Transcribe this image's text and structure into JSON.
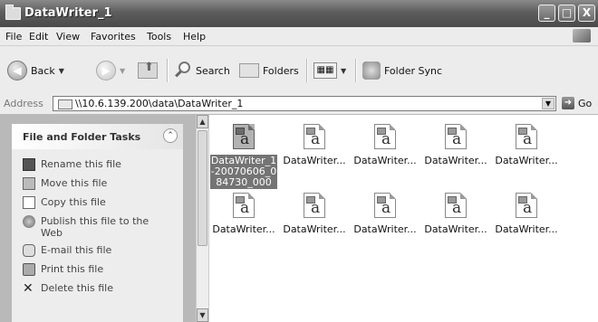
{
  "window": {
    "title": "DataWriter_1",
    "buttons": {
      "minimize": "_",
      "maximize": "□",
      "close": "X"
    }
  },
  "menu": {
    "file": "File",
    "edit": "Edit",
    "view": "View",
    "favorites": "Favorites",
    "tools": "Tools",
    "help": "Help"
  },
  "toolbar": {
    "back": "Back",
    "search": "Search",
    "folders": "Folders",
    "folder_sync": "Folder Sync"
  },
  "address": {
    "label": "Address",
    "value": "\\\\10.6.139.200\\data\\DataWriter_1",
    "go": "Go"
  },
  "tasks": {
    "title": "File and Folder Tasks",
    "items": [
      {
        "label": "Rename this file",
        "icon": "rename-icon"
      },
      {
        "label": "Move this file",
        "icon": "move-icon"
      },
      {
        "label": "Copy this file",
        "icon": "copy-icon"
      },
      {
        "label": "Publish this file to the Web",
        "icon": "publish-icon"
      },
      {
        "label": "E-mail this file",
        "icon": "email-icon"
      },
      {
        "label": "Print this file",
        "icon": "print-icon"
      },
      {
        "label": "Delete this file",
        "icon": "delete-icon"
      }
    ]
  },
  "files": [
    {
      "name": "DataWriter_1-20070606_084730_000",
      "selected": true
    },
    {
      "name": "DataWriter..."
    },
    {
      "name": "DataWriter..."
    },
    {
      "name": "DataWriter..."
    },
    {
      "name": "DataWriter..."
    },
    {
      "name": "DataWriter..."
    },
    {
      "name": "DataWriter..."
    },
    {
      "name": "DataWriter..."
    },
    {
      "name": "DataWriter..."
    },
    {
      "name": "DataWriter..."
    }
  ]
}
